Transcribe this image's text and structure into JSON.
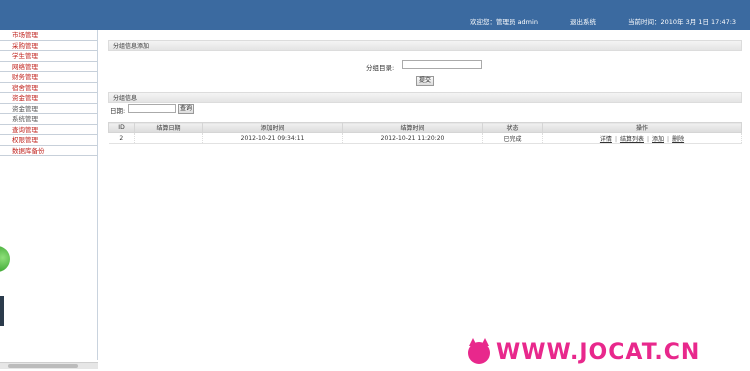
{
  "header": {
    "user_info": "欢迎您：管理员 admin",
    "logout": "退出系统",
    "datetime": "当前时间：2010年 3月 1日 17:47:3"
  },
  "sidebar": {
    "items": [
      {
        "label": "市场管理",
        "style": "red"
      },
      {
        "label": "采购管理",
        "style": "red"
      },
      {
        "label": "学生管理",
        "style": "red"
      },
      {
        "label": "网络管理",
        "style": "red"
      },
      {
        "label": "财务管理",
        "style": "red"
      },
      {
        "label": "宿舍管理",
        "style": "red"
      },
      {
        "label": "资金管理",
        "style": "red"
      },
      {
        "label": "资金管理",
        "style": "gray"
      },
      {
        "label": "系统管理",
        "style": "gray"
      },
      {
        "label": "查询管理",
        "style": "red"
      },
      {
        "label": "权限管理",
        "style": "red"
      },
      {
        "label": "数据库备份",
        "style": "red"
      }
    ]
  },
  "add_panel": {
    "title": "分组信息添加",
    "field_label": "分组目录:",
    "field_value": "",
    "submit_label": "提交"
  },
  "list_panel": {
    "title": "分组信息",
    "search_label": "日期:",
    "search_value": "",
    "query_label": "查询",
    "columns": [
      "ID",
      "结算日期",
      "添加时间",
      "结算时间",
      "状态",
      "操作"
    ],
    "rows": [
      {
        "id": "2",
        "settle_date": "",
        "add_time": "2012-10-21 09:34:11",
        "settle_time": "2012-10-21 11:20:20",
        "status": "已完成",
        "ops": [
          "详情",
          "结算列表",
          "添加",
          "删除"
        ]
      }
    ]
  },
  "watermark": {
    "text": "WWW.JOCAT.CN",
    "color": "#e8288c"
  },
  "colors": {
    "header_bg": "#3b6aa0",
    "menu_red": "#c0231e"
  }
}
